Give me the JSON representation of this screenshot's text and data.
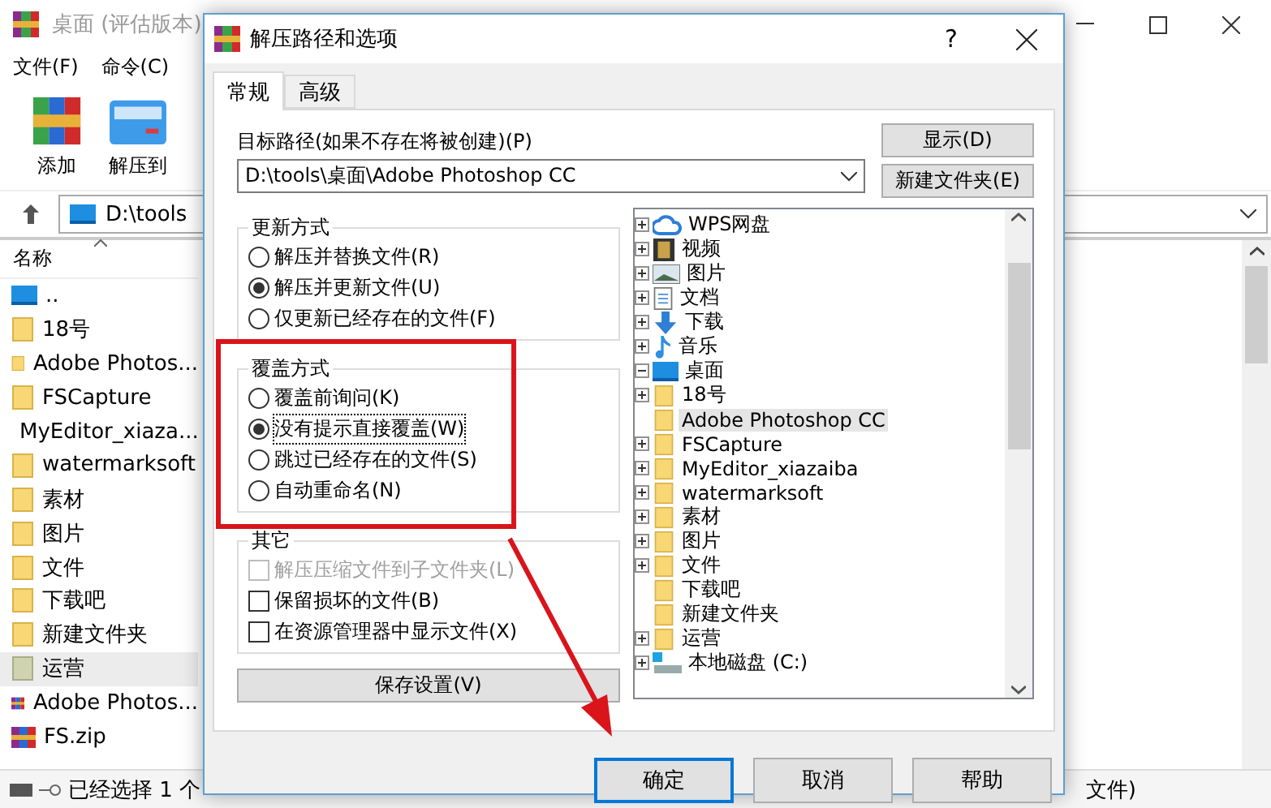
{
  "main_window": {
    "title": "桌面 (评估版本)",
    "menu": [
      "文件(F)",
      "命令(C)"
    ],
    "toolbar": [
      "添加",
      "解压到"
    ],
    "address": "D:\\tools",
    "list_header": "名称",
    "files": [
      {
        "name": "..",
        "kind": "parent",
        "selected": false
      },
      {
        "name": "18号",
        "kind": "folder",
        "selected": false
      },
      {
        "name": "Adobe Photos...",
        "kind": "folder",
        "selected": false
      },
      {
        "name": "FSCapture",
        "kind": "folder",
        "selected": false
      },
      {
        "name": "MyEditor_xiaza...",
        "kind": "folder",
        "selected": false
      },
      {
        "name": "watermarksoft",
        "kind": "folder",
        "selected": false
      },
      {
        "name": "素材",
        "kind": "folder",
        "selected": false
      },
      {
        "name": "图片",
        "kind": "folder",
        "selected": false
      },
      {
        "name": "文件",
        "kind": "folder",
        "selected": false
      },
      {
        "name": "下载吧",
        "kind": "folder",
        "selected": false
      },
      {
        "name": "新建文件夹",
        "kind": "folder",
        "selected": false
      },
      {
        "name": "运营",
        "kind": "special",
        "selected": true
      },
      {
        "name": "Adobe Photos...",
        "kind": "archive",
        "selected": false
      },
      {
        "name": "FS.zip",
        "kind": "archive",
        "selected": false
      }
    ],
    "status": [
      "已经选择 1 个",
      "文件)"
    ]
  },
  "dialog": {
    "title": "解压路径和选项",
    "help": "?",
    "tabs": [
      {
        "label": "常规",
        "selected": true
      },
      {
        "label": "高级",
        "selected": false
      }
    ],
    "path_label": "目标路径(如果不存在将被创建)(P)",
    "path_value": "D:\\tools\\桌面\\Adobe Photoshop CC",
    "side_buttons": [
      "显示(D)",
      "新建文件夹(E)"
    ],
    "update_mode": {
      "title": "更新方式",
      "options": [
        {
          "label": "解压并替换文件(R)",
          "selected": false
        },
        {
          "label": "解压并更新文件(U)",
          "selected": true
        },
        {
          "label": "仅更新已经存在的文件(F)",
          "selected": false
        }
      ]
    },
    "overwrite_mode": {
      "title": "覆盖方式",
      "options": [
        {
          "label": "覆盖前询问(K)",
          "selected": false
        },
        {
          "label": "没有提示直接覆盖(W)",
          "selected": true
        },
        {
          "label": "跳过已经存在的文件(S)",
          "selected": false
        },
        {
          "label": "自动重命名(N)",
          "selected": false
        }
      ]
    },
    "other": {
      "title": "其它",
      "options": [
        {
          "label": "解压压缩文件到子文件夹(L)",
          "checked": false,
          "disabled": true
        },
        {
          "label": "保留损坏的文件(B)",
          "checked": false,
          "disabled": false
        },
        {
          "label": "在资源管理器中显示文件(X)",
          "checked": false,
          "disabled": false
        }
      ]
    },
    "save_button": "保存设置(V)",
    "tree": [
      {
        "label": "WPS网盘",
        "kind": "cloud",
        "expanded": false,
        "selected": false
      },
      {
        "label": "视频",
        "kind": "video",
        "expanded": false,
        "selected": false
      },
      {
        "label": "图片",
        "kind": "image",
        "expanded": false,
        "selected": false
      },
      {
        "label": "文档",
        "kind": "document",
        "expanded": false,
        "selected": false
      },
      {
        "label": "下载",
        "kind": "download",
        "expanded": false,
        "selected": false
      },
      {
        "label": "音乐",
        "kind": "music",
        "expanded": false,
        "selected": false
      },
      {
        "label": "桌面",
        "kind": "desktop",
        "expanded": true,
        "selected": false,
        "children": [
          {
            "label": "18号",
            "kind": "folder",
            "expanded": false,
            "selected": false
          },
          {
            "label": "Adobe Photoshop CC",
            "kind": "folder",
            "selected": true
          },
          {
            "label": "FSCapture",
            "kind": "folder",
            "expanded": false,
            "selected": false
          },
          {
            "label": "MyEditor_xiazaiba",
            "kind": "folder",
            "expanded": false,
            "selected": false
          },
          {
            "label": "watermarksoft",
            "kind": "folder",
            "expanded": false,
            "selected": false
          },
          {
            "label": "素材",
            "kind": "folder",
            "expanded": false,
            "selected": false
          },
          {
            "label": "图片",
            "kind": "folder",
            "expanded": false,
            "selected": false
          },
          {
            "label": "文件",
            "kind": "folder",
            "expanded": false,
            "selected": false
          },
          {
            "label": "下载吧",
            "kind": "folder",
            "selected": false
          },
          {
            "label": "新建文件夹",
            "kind": "folder",
            "selected": false
          },
          {
            "label": "运营",
            "kind": "folder",
            "expanded": false,
            "selected": false
          }
        ]
      },
      {
        "label": "本地磁盘 (C:)",
        "kind": "drive",
        "expanded": false,
        "selected": false
      }
    ],
    "buttons": [
      {
        "label": "确定",
        "selected": true
      },
      {
        "label": "取消",
        "selected": false
      },
      {
        "label": "帮助",
        "selected": false
      }
    ]
  }
}
